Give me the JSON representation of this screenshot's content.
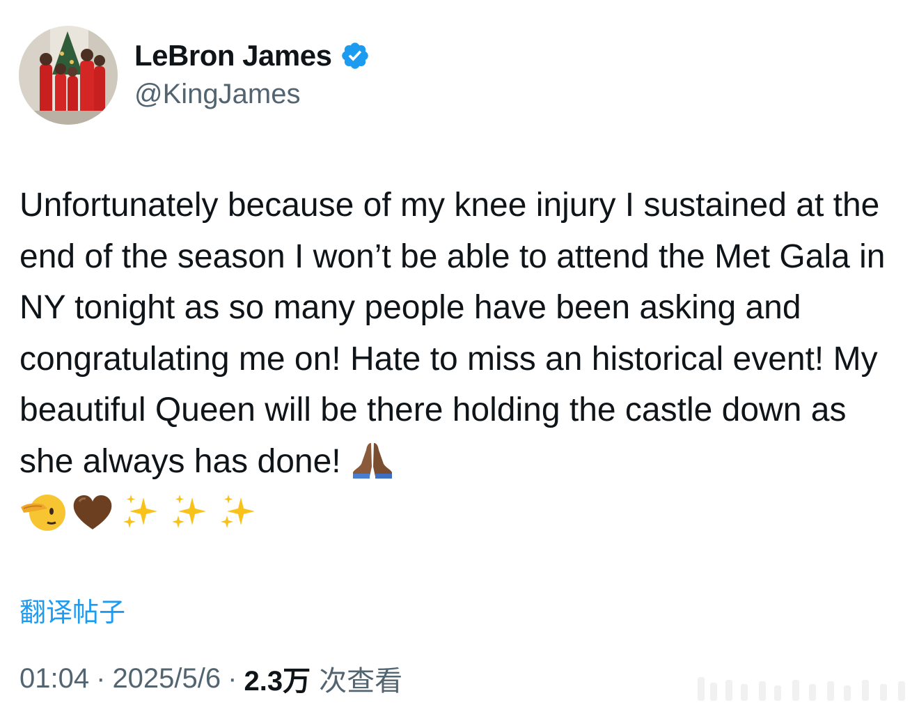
{
  "author": {
    "display_name": "LeBron James",
    "handle": "@KingJames",
    "verified": true
  },
  "tweet": {
    "text": "Unfortunately because of my knee injury I sustained at the end of the season I won’t be able to attend the Met Gala in NY tonight as so many people have been asking and congratulating me on! Hate to miss an historical event! My beautiful Queen will be there holding the castle down as she always has done!",
    "emojis": [
      "pray-icon",
      "saluting-face-icon",
      "brown-heart-icon",
      "sparkles-icon",
      "sparkles-icon",
      "sparkles-icon"
    ]
  },
  "translate_label": "翻译帖子",
  "meta": {
    "time": "01:04",
    "separator": "·",
    "date": "2025/5/6",
    "views_count": "2.3万",
    "views_label": "次查看"
  },
  "colors": {
    "text": "#0f1419",
    "secondary": "#536471",
    "accent": "#1d9bf0"
  }
}
